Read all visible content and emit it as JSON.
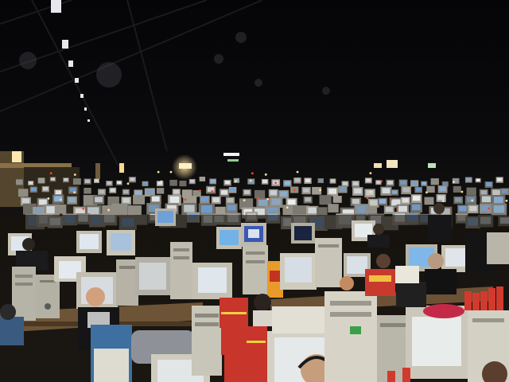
{
  "photo": {
    "subject": "lan-party-hall",
    "palette": {
      "ceiling": "#0a0a0c",
      "haze": "#161514",
      "floor": "#2b2218",
      "table": "#6b5236",
      "monitor_beige": "#c9c4b4",
      "monitor_grey": "#9ea4a6",
      "screen_white": "#d8dfe6",
      "screen_blue": "#6f9fd8",
      "crate_red": "#c8352a",
      "can_red": "#d23a2e",
      "light_warm": "#ffd890"
    }
  }
}
